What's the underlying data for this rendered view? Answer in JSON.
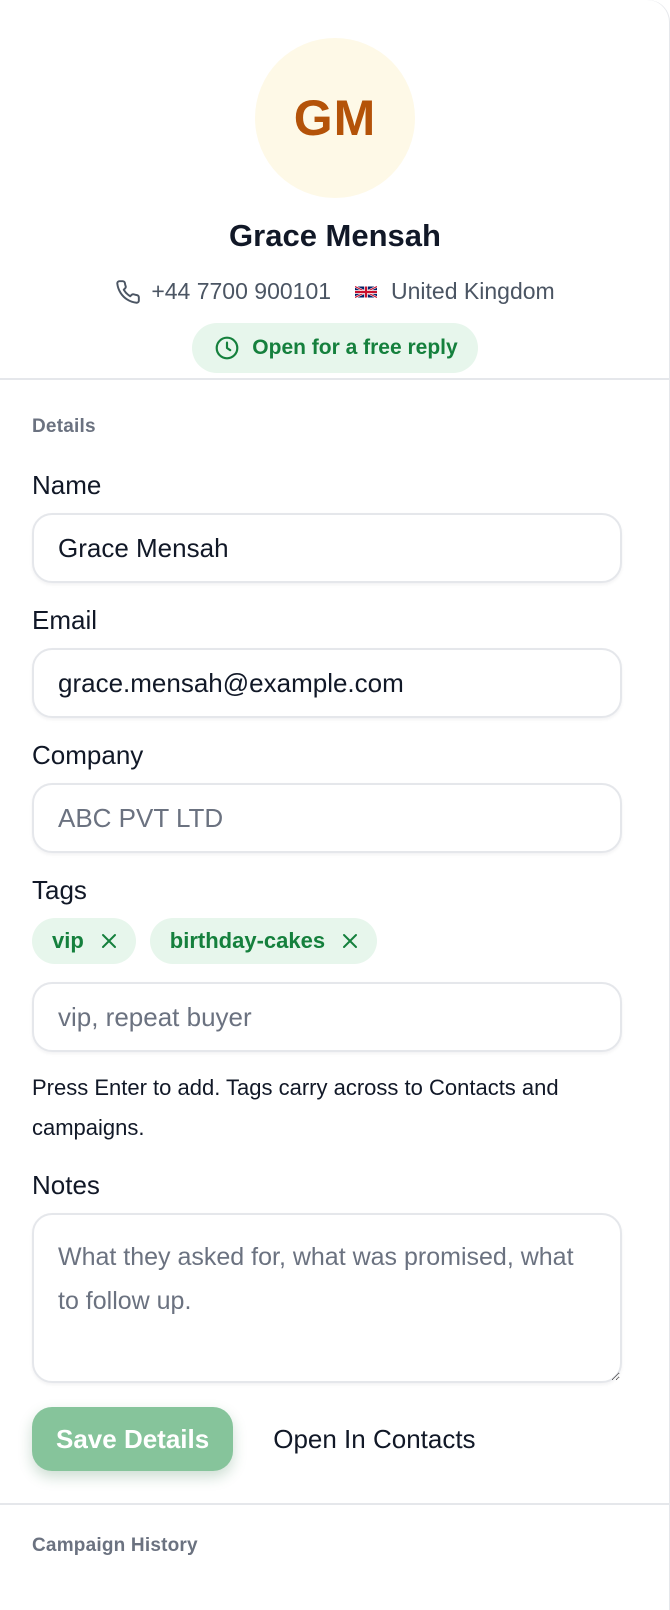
{
  "colors": {
    "avatar_bg": "#fef9e7",
    "avatar_text": "#b45309",
    "status_bg": "#e7f6ec",
    "status_text": "#15803d",
    "tag_bg": "#e7f6ec",
    "tag_text": "#15803d",
    "save_button_bg": "#86c49b"
  },
  "profile": {
    "initials": "GM",
    "name": "Grace Mensah",
    "phone": "+44 7700 900101",
    "phone_icon": "phone-icon",
    "flag_icon": "uk-flag-icon",
    "country": "United Kingdom",
    "status": "Open for a free reply",
    "status_icon": "clock-icon"
  },
  "details": {
    "section_title": "Details",
    "name": {
      "label": "Name",
      "value": "Grace Mensah"
    },
    "email": {
      "label": "Email",
      "value": "grace.mensah@example.com"
    },
    "company": {
      "label": "Company",
      "value": "",
      "placeholder": "ABC PVT LTD"
    },
    "tags": {
      "label": "Tags",
      "items": [
        {
          "label": "vip"
        },
        {
          "label": "birthday-cakes"
        }
      ],
      "remove_icon": "close-icon",
      "input_placeholder": "vip, repeat buyer",
      "help": "Press Enter to add. Tags carry across to Contacts and campaigns."
    },
    "notes": {
      "label": "Notes",
      "placeholder": "What they asked for, what was promised, what to follow up.",
      "value": ""
    },
    "actions": {
      "save_label": "Save Details",
      "open_contacts_label": "Open In Contacts"
    }
  },
  "campaign_history": {
    "section_title": "Campaign History"
  }
}
